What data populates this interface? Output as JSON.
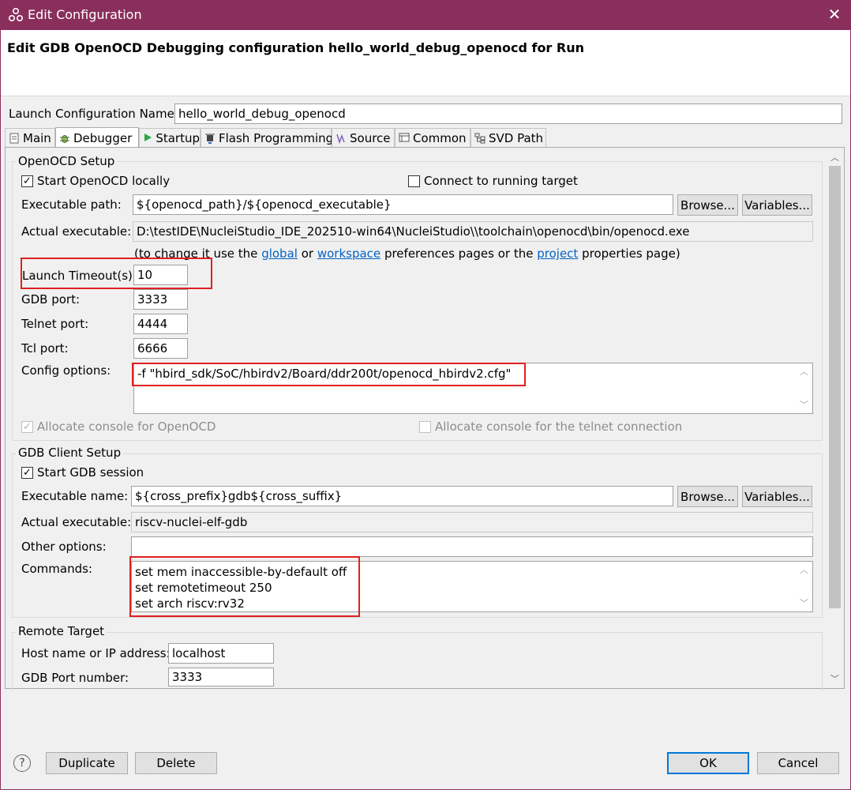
{
  "window": {
    "title": "Edit Configuration",
    "close_glyph": "✕",
    "icon": "nuclei-logo-icon"
  },
  "header": {
    "heading": "Edit GDB OpenOCD Debugging configuration hello_world_debug_openocd for Run"
  },
  "launch_name": {
    "label": "Launch Configuration Name:",
    "value": "hello_world_debug_openocd"
  },
  "tabs": [
    {
      "label": "Main",
      "icon": "document-icon"
    },
    {
      "label": "Debugger",
      "icon": "bug-icon"
    },
    {
      "label": "Startup",
      "icon": "play-icon"
    },
    {
      "label": "Flash Programming",
      "icon": "chip-icon"
    },
    {
      "label": "Source",
      "icon": "source-icon"
    },
    {
      "label": "Common",
      "icon": "common-icon"
    },
    {
      "label": "SVD Path",
      "icon": "svd-icon"
    }
  ],
  "openocd": {
    "group_title": "OpenOCD Setup",
    "start_locally": {
      "label": "Start OpenOCD locally",
      "checked": true
    },
    "connect_running": {
      "label": "Connect to running target",
      "checked": false
    },
    "exec_path": {
      "label": "Executable path:",
      "value": "${openocd_path}/${openocd_executable}"
    },
    "browse_label": "Browse...",
    "variables_label": "Variables...",
    "actual_exec": {
      "label": "Actual executable:",
      "value": "D:\\testIDE\\NucleiStudio_IDE_202510-win64\\NucleiStudio\\\\toolchain\\openocd\\bin/openocd.exe"
    },
    "hint": {
      "prefix": "(to change it use the",
      "global": "global",
      "or": "or",
      "workspace": "workspace",
      "mid": "preferences pages or the",
      "project": "project",
      "suffix": "properties page)"
    },
    "launch_timeout": {
      "label": "Launch Timeout(s):",
      "value": "10"
    },
    "gdb_port": {
      "label": "GDB port:",
      "value": "3333"
    },
    "telnet_port": {
      "label": "Telnet port:",
      "value": "4444"
    },
    "tcl_port": {
      "label": "Tcl port:",
      "value": "6666"
    },
    "config_options": {
      "label": "Config options:",
      "value": "-f \"hbird_sdk/SoC/hbirdv2/Board/ddr200t/openocd_hbirdv2.cfg\""
    },
    "alloc_console": {
      "label": "Allocate console for OpenOCD",
      "checked": true
    },
    "alloc_telnet": {
      "label": "Allocate console for the telnet connection",
      "checked": false
    }
  },
  "gdb_client": {
    "group_title": "GDB Client Setup",
    "start_session": {
      "label": "Start GDB session",
      "checked": true
    },
    "exec_name": {
      "label": "Executable name:",
      "value": "${cross_prefix}gdb${cross_suffix}"
    },
    "browse_label": "Browse...",
    "variables_label": "Variables...",
    "actual_exec": {
      "label": "Actual executable:",
      "value": "riscv-nuclei-elf-gdb"
    },
    "other_options": {
      "label": "Other options:",
      "value": ""
    },
    "commands": {
      "label": "Commands:",
      "lines": [
        "set mem inaccessible-by-default off",
        "set remotetimeout 250",
        "set arch riscv:rv32"
      ]
    }
  },
  "remote": {
    "group_title": "Remote Target",
    "host": {
      "label": "Host name or IP address:",
      "value": "localhost"
    },
    "port": {
      "label": "GDB Port number:",
      "value": "3333"
    }
  },
  "footer": {
    "help_glyph": "?",
    "duplicate": "Duplicate",
    "delete": "Delete",
    "ok": "OK",
    "cancel": "Cancel"
  },
  "check_glyph": "✓",
  "colors": {
    "titlebar": "#8a2f5c",
    "highlight_box": "#e02020",
    "link": "#0563c1",
    "accent": "#0078d7"
  }
}
